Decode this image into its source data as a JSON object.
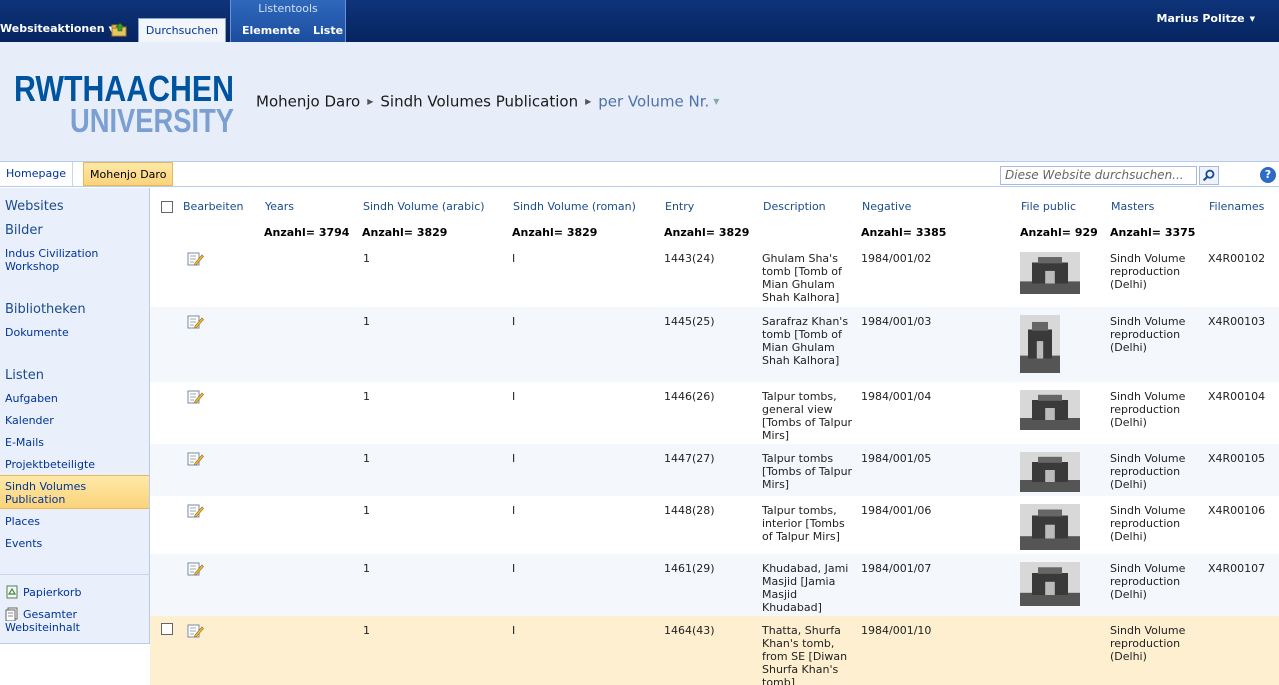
{
  "ribbon": {
    "site_actions": "Websiteaktionen",
    "tab_browse": "Durchsuchen",
    "context_title": "Listentools",
    "tab_items": "Elemente",
    "tab_list": "Liste",
    "user": "Marius Politze"
  },
  "logo": {
    "line1": "RWTHAACHEN",
    "line2": "UNIVERSITY"
  },
  "breadcrumb": {
    "site": "Mohenjo Daro",
    "list": "Sindh Volumes Publication",
    "view": "per Volume Nr."
  },
  "topnav": {
    "home": "Homepage",
    "current": "Mohenjo Daro",
    "search_placeholder": "Diese Website durchsuchen..."
  },
  "leftnav": {
    "websites": "Websites",
    "bilder": "Bilder",
    "bilder_items": [
      "Indus Civilization Workshop"
    ],
    "bibliotheken": "Bibliotheken",
    "bibliotheken_items": [
      "Dokumente"
    ],
    "listen": "Listen",
    "listen_items": [
      "Aufgaben",
      "Kalender",
      "E-Mails",
      "Projektbeteiligte",
      "Sindh Volumes Publication",
      "Places",
      "Events"
    ],
    "recycle": "Papierkorb",
    "all_content": "Gesamter Websiteinhalt"
  },
  "table": {
    "headers": [
      "Bearbeiten",
      "Years",
      "Sindh Volume (arabic)",
      "Sindh Volume (roman)",
      "Entry",
      "Description",
      "Negative",
      "File public",
      "Masters",
      "Filenames"
    ],
    "aggregates": {
      "years": "Anzahl= 3794",
      "arabic": "Anzahl= 3829",
      "roman": "Anzahl= 3829",
      "entry": "Anzahl= 3829",
      "negative": "Anzahl= 3385",
      "file_public": "Anzahl= 929",
      "masters": "Anzahl= 3375"
    },
    "rows": [
      {
        "arabic": "1",
        "roman": "I",
        "entry": "1443(24)",
        "description": "Ghulam Sha's tomb [Tomb of Mian Ghulam Shah Kalhora]",
        "negative": "1984/001/02",
        "masters": "Sindh Volume reproduction (Delhi)",
        "filename": "X4R00102",
        "thumb": "tomb-photo"
      },
      {
        "arabic": "1",
        "roman": "I",
        "entry": "1445(25)",
        "description": "Sarafraz Khan's tomb [Tomb of Mian Ghulam Shah Kalhora]",
        "negative": "1984/001/03",
        "masters": "Sindh Volume reproduction (Delhi)",
        "filename": "X4R00103",
        "thumb": "dome-photo"
      },
      {
        "arabic": "1",
        "roman": "I",
        "entry": "1446(26)",
        "description": "Talpur tombs, general view [Tombs of Talpur Mirs]",
        "negative": "1984/001/04",
        "masters": "Sindh Volume reproduction (Delhi)",
        "filename": "X4R00104",
        "thumb": "landscape-photo"
      },
      {
        "arabic": "1",
        "roman": "I",
        "entry": "1447(27)",
        "description": "Talpur tombs [Tombs of Talpur Mirs]",
        "negative": "1984/001/05",
        "masters": "Sindh Volume reproduction (Delhi)",
        "filename": "X4R00105",
        "thumb": "building-photo"
      },
      {
        "arabic": "1",
        "roman": "I",
        "entry": "1448(28)",
        "description": "Talpur tombs, interior [Tombs of Talpur Mirs]",
        "negative": "1984/001/06",
        "masters": "Sindh Volume reproduction (Delhi)",
        "filename": "X4R00106",
        "thumb": "interior-photo"
      },
      {
        "arabic": "1",
        "roman": "I",
        "entry": "1461(29)",
        "description": "Khudabad, Jami Masjid [Jamia Masjid Khudabad]",
        "negative": "1984/001/07",
        "masters": "Sindh Volume reproduction (Delhi)",
        "filename": "X4R00107",
        "thumb": "mosque-photo"
      },
      {
        "arabic": "1",
        "roman": "I",
        "entry": "1464(43)",
        "description": "Thatta, Shurfa Khan's tomb, from SE [Diwan Shurfa Khan's tomb]",
        "negative": "1984/001/10",
        "masters": "Sindh Volume reproduction (Delhi)",
        "filename": "",
        "thumb": ""
      }
    ]
  },
  "colors": {
    "ribbon": "#0a2c6e",
    "accent": "#fdd98b",
    "link": "#003399",
    "header_bg": "#e7eefa"
  }
}
